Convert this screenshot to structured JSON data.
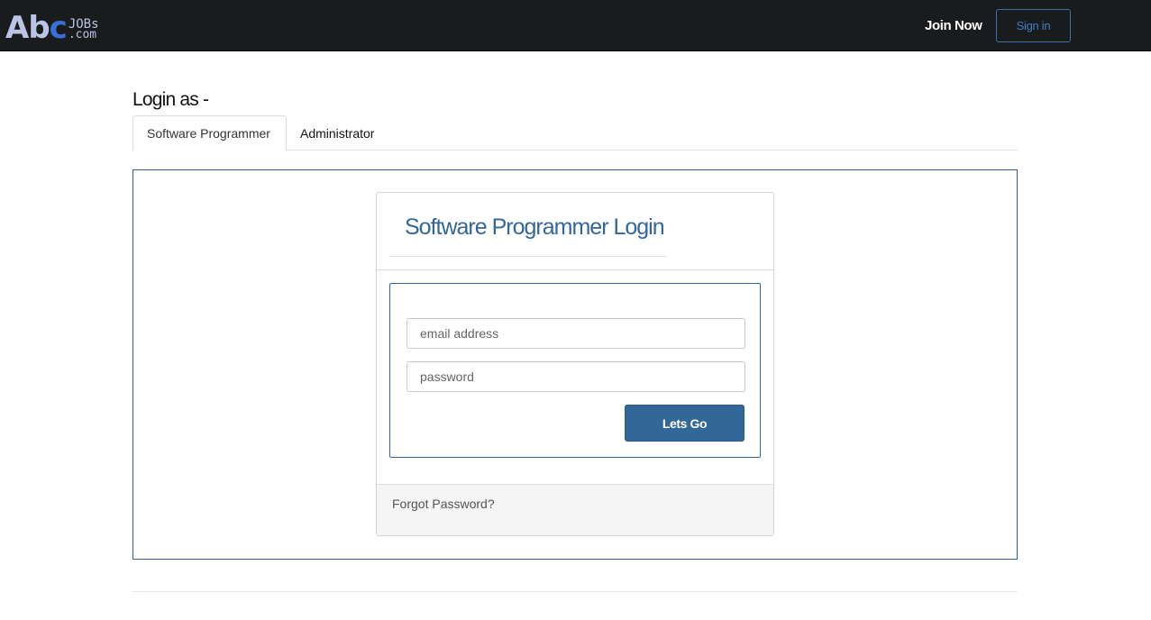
{
  "navbar": {
    "logo": {
      "abc_prefix": "Ab",
      "abc_suffix": "c",
      "jobs_top": "JOBs",
      "jobs_bottom": ".com"
    },
    "join_label": "Join Now",
    "signin_label": "Sign in"
  },
  "page": {
    "login_as_heading": "Login as -"
  },
  "tabs": [
    {
      "label": "Software Programmer",
      "active": true
    },
    {
      "label": "Administrator",
      "active": false
    }
  ],
  "login_card": {
    "title": "Software Programmer Login",
    "email_placeholder": "email address",
    "email_value": "",
    "password_placeholder": "password",
    "password_value": "",
    "submit_label": "Lets Go",
    "forgot_label": "Forgot Password?"
  },
  "colors": {
    "navbar_bg": "#1a1b1c",
    "accent": "#336699",
    "signin_border": "#3c6fa8"
  }
}
